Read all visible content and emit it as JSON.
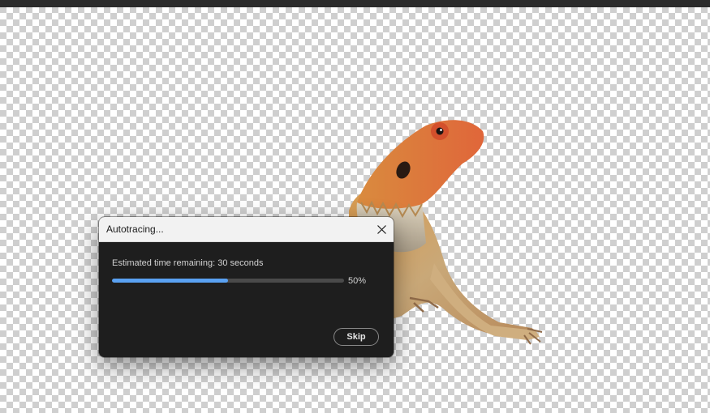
{
  "dialog": {
    "title": "Autotracing...",
    "status_text": "Estimated time remaining: 30 seconds",
    "progress_fraction": 0.5,
    "progress_label": "50%",
    "skip_label": "Skip",
    "close_icon": "close-icon"
  },
  "canvas": {
    "image_subject": "lizard",
    "background": "transparency-checkerboard"
  },
  "colors": {
    "progress_fill": "#5aa1f2",
    "dialog_body": "#1e1e1e",
    "titlebar": "#f2f2f2"
  }
}
